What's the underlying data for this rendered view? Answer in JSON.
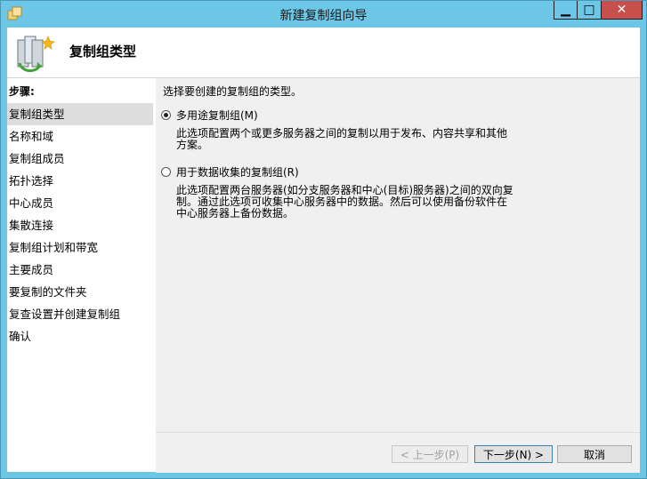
{
  "window": {
    "title": "新建复制组向导"
  },
  "header": {
    "title": "复制组类型"
  },
  "sidebar": {
    "steps_label": "步骤:",
    "steps": [
      "复制组类型",
      "名称和域",
      "复制组成员",
      "拓扑选择",
      "中心成员",
      "集散连接",
      "复制组计划和带宽",
      "主要成员",
      "要复制的文件夹",
      "复查设置并创建复制组",
      "确认"
    ],
    "active_index": 0
  },
  "main": {
    "prompt": "选择要创建的复制组的类型。",
    "options": [
      {
        "label": "多用途复制组(M)",
        "description": "此选项配置两个或更多服务器之间的复制以用于发布、内容共享和其他方案。",
        "checked": true
      },
      {
        "label": "用于数据收集的复制组(R)",
        "description": "此选项配置两台服务器(如分支服务器和中心(目标)服务器)之间的双向复制。通过此选项可收集中心服务器中的数据。然后可以使用备份软件在中心服务器上备份数据。",
        "checked": false
      }
    ]
  },
  "footer": {
    "back_label": "< 上一步(P)",
    "next_label": "下一步(N) >",
    "cancel_label": "取消"
  },
  "colors": {
    "titlebar": "#6cc7e6",
    "close_button": "#c7504c",
    "content_bg": "#f0f0f0",
    "active_step": "#dddddd"
  }
}
